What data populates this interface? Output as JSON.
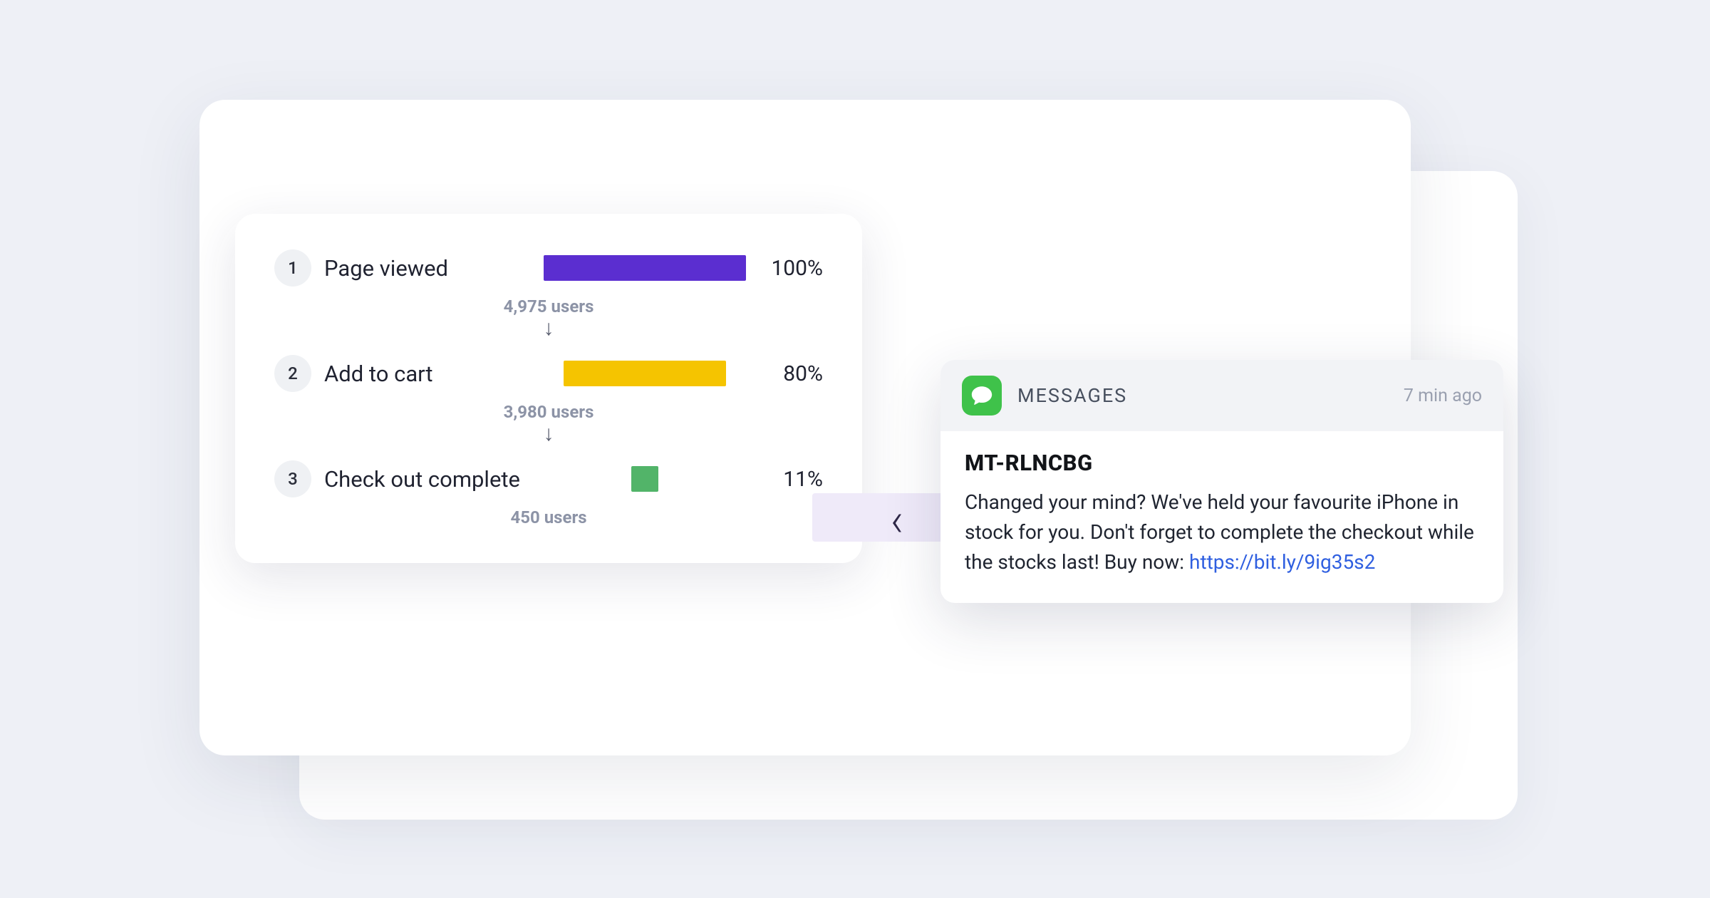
{
  "funnel": {
    "steps": [
      {
        "num": "1",
        "label": "Page viewed",
        "pct": "100%",
        "users": "4,975 users",
        "color": "purple"
      },
      {
        "num": "2",
        "label": "Add to cart",
        "pct": "80%",
        "users": "3,980 users",
        "color": "yellow"
      },
      {
        "num": "3",
        "label": "Check out complete",
        "pct": "11%",
        "users": "450 users",
        "color": "green"
      }
    ],
    "arrow": "↓"
  },
  "connector": {
    "chevron": "‹"
  },
  "notification": {
    "app": "MESSAGES",
    "time": "7 min ago",
    "title": "MT-RLNCBG",
    "body_prefix": "Changed your mind? We've held your favourite iPhone in stock for you. Don't forget to complete the checkout while the stocks last! Buy now: ",
    "link_text": "https://bit.ly/9ig35s2"
  },
  "chart_data": {
    "type": "bar",
    "title": "",
    "orientation": "horizontal",
    "categories": [
      "Page viewed",
      "Add to cart",
      "Check out complete"
    ],
    "series": [
      {
        "name": "Conversion %",
        "values": [
          100,
          80,
          11
        ]
      },
      {
        "name": "Users",
        "values": [
          4975,
          3980,
          450
        ]
      }
    ],
    "xlabel": "",
    "ylabel": "",
    "ylim": [
      0,
      100
    ]
  }
}
